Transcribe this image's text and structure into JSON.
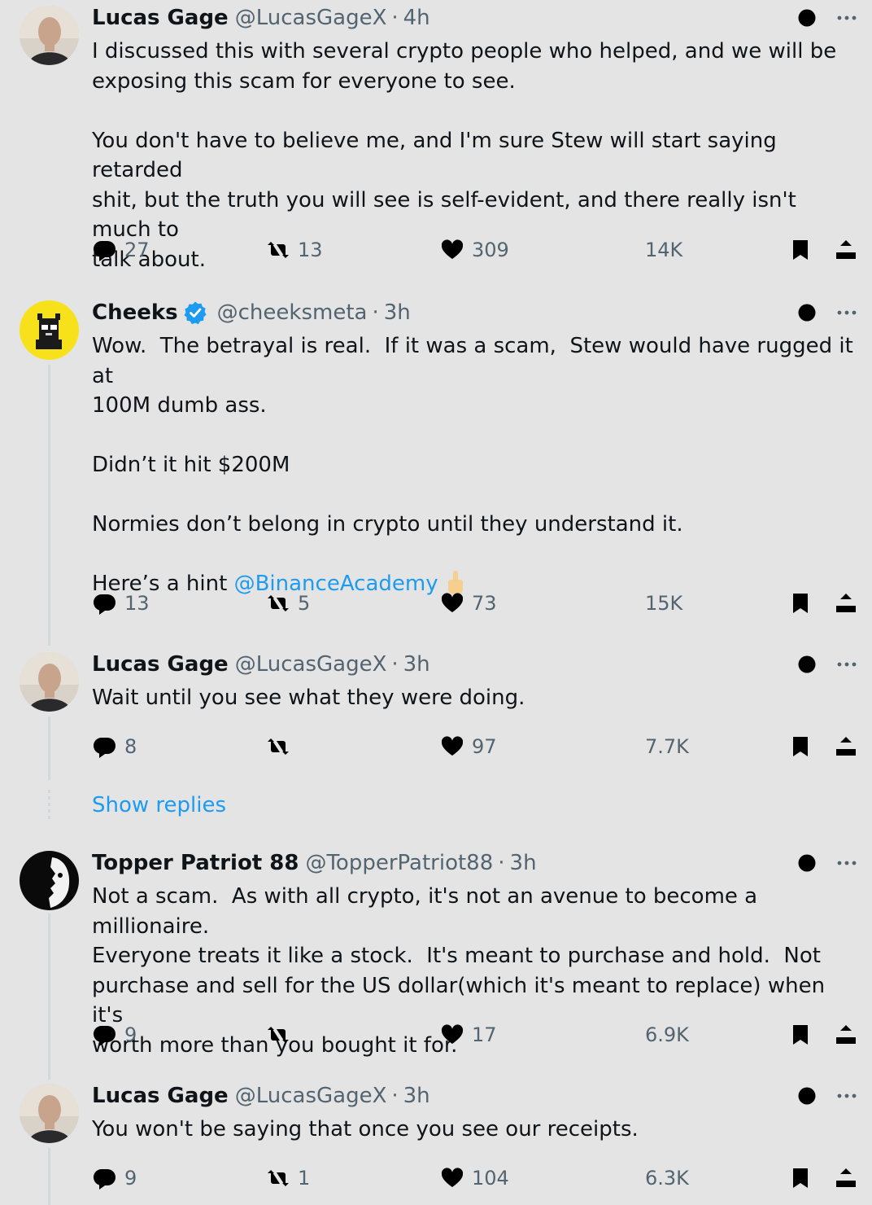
{
  "tweets": [
    {
      "name": "Lucas Gage",
      "handle": "@LucasGageX",
      "time": "4h",
      "verified": false,
      "text": "I discussed this with several crypto people who helped, and we will be\nexposing this scam for everyone to see.\n\nYou don't have to believe me, and I'm sure Stew will start saying retarded\nshit, but the truth you will see is self-evident, and there really isn't much to\ntalk about.",
      "replies": "27",
      "reposts": "13",
      "likes": "309",
      "views": "14K"
    },
    {
      "name": "Cheeks",
      "handle": "@cheeksmeta",
      "time": "3h",
      "verified": true,
      "text": "Wow.  The betrayal is real.  If it was a scam,  Stew would have rugged it at\n100M dumb ass.\n\nDidn’t it hit $200M\n\nNormies don’t belong in crypto until they understand it.\n\nHere’s a hint ",
      "mention": "@BinanceAcademy",
      "replies": "13",
      "reposts": "5",
      "likes": "73",
      "views": "15K"
    },
    {
      "name": "Lucas Gage",
      "handle": "@LucasGageX",
      "time": "3h",
      "verified": false,
      "text": "Wait until you see what they were doing.",
      "replies": "8",
      "reposts": "",
      "likes": "97",
      "views": "7.7K"
    },
    {
      "name": "Topper Patriot 88",
      "handle": "@TopperPatriot88",
      "time": "3h",
      "verified": false,
      "text": "Not a scam.  As with all crypto, it's not an avenue to become a millionaire.\nEveryone treats it like a stock.  It's meant to purchase and hold.  Not\npurchase and sell for the US dollar(which it's meant to replace) when it's\nworth more than you bought it for.",
      "replies": "9",
      "reposts": "",
      "likes": "17",
      "views": "6.9K"
    },
    {
      "name": "Lucas Gage",
      "handle": "@LucasGageX",
      "time": "3h",
      "verified": false,
      "text": "You won't be saying that once you see our receipts.",
      "replies": "9",
      "reposts": "1",
      "likes": "104",
      "views": "6.3K"
    }
  ],
  "show_replies": "Show replies",
  "separator": "·",
  "colors": {
    "accent": "#1d9bf0",
    "muted": "#536471",
    "background": "#e4e4e4"
  },
  "icons": [
    "grok-icon",
    "more-icon",
    "reply-icon",
    "repost-icon",
    "like-icon",
    "views-icon",
    "bookmark-icon",
    "share-icon",
    "verified-badge-icon",
    "middle-finger-emoji-icon"
  ]
}
